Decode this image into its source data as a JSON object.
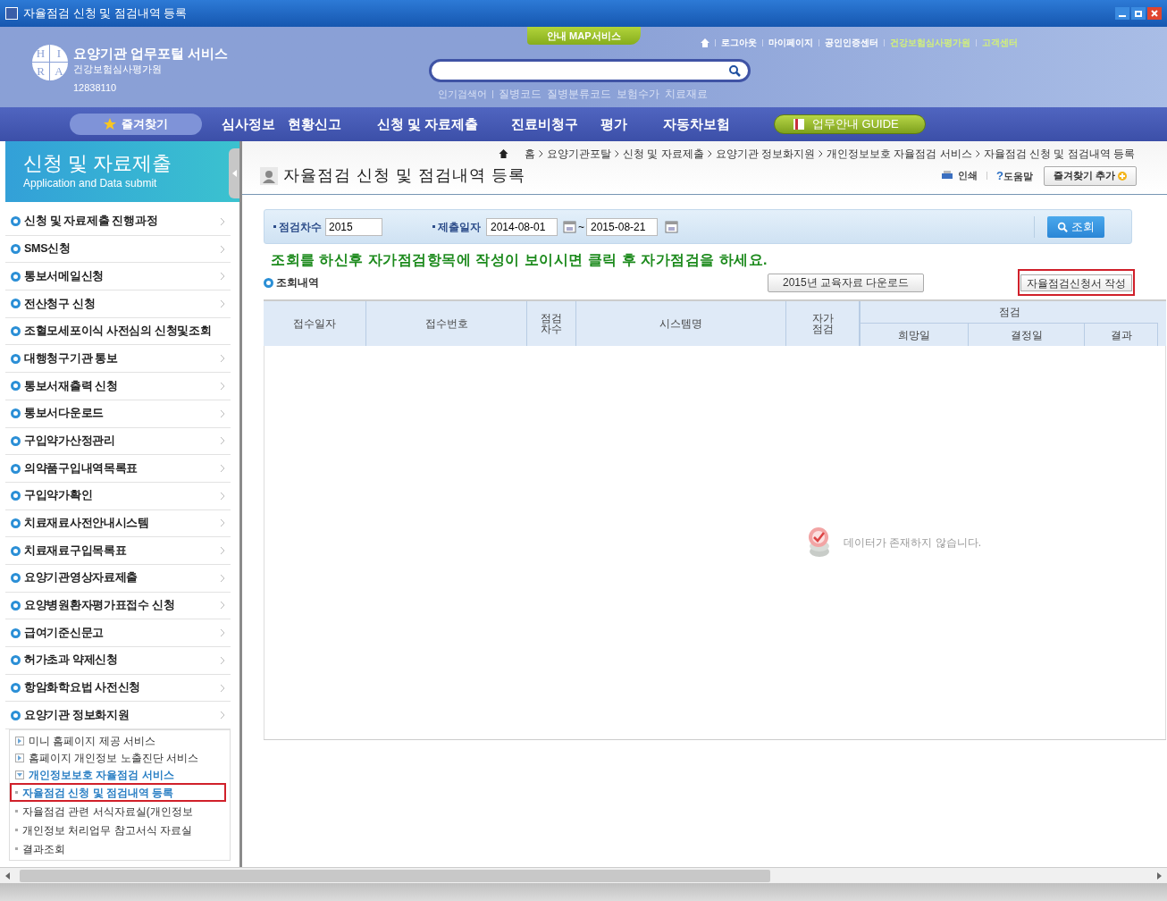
{
  "window": {
    "title": "자율점검 신청 및 점검내역 등록"
  },
  "header": {
    "logo_letters": [
      "H",
      "I",
      "R",
      "A"
    ],
    "org_name": "요양기관 업무포털 서비스",
    "org_subtitle": "건강보험심사평가원",
    "user_id": "12838110",
    "map_tab": "안내 MAP서비스",
    "top_links": [
      {
        "label": "로그아웃",
        "highlight": false
      },
      {
        "label": "마이페이지",
        "highlight": false
      },
      {
        "label": "공인인증센터",
        "highlight": false
      },
      {
        "label": "건강보험심사평가원",
        "highlight": true
      },
      {
        "label": "고객센터",
        "highlight": true
      }
    ],
    "quick_label": "인기검색어",
    "quick_links": [
      "질병코드",
      "질병분류코드",
      "보험수가",
      "치료재료"
    ]
  },
  "nav": {
    "favorites": "즐겨찾기",
    "items": [
      "심사정보",
      "현황신고",
      "신청 및 자료제출",
      "진료비청구",
      "평가",
      "자동차보험"
    ],
    "guide": "업무안내 GUIDE"
  },
  "sidebar": {
    "title": "신청 및 자료제출",
    "subtitle": "Application and Data submit",
    "items": [
      {
        "label": "신청 및 자료제출 진행과정",
        "arrow": true
      },
      {
        "label": "SMS신청",
        "arrow": true
      },
      {
        "label": "통보서메일신청",
        "arrow": true
      },
      {
        "label": "전산청구 신청",
        "arrow": true
      },
      {
        "label": "조혈모세포이식 사전심의 신청및조회",
        "arrow": false
      },
      {
        "label": "대행청구기관 통보",
        "arrow": true
      },
      {
        "label": "통보서재출력 신청",
        "arrow": true
      },
      {
        "label": "통보서다운로드",
        "arrow": true
      },
      {
        "label": "구입약가산정관리",
        "arrow": true
      },
      {
        "label": "의약품구입내역목록표",
        "arrow": true
      },
      {
        "label": "구입약가확인",
        "arrow": true
      },
      {
        "label": "치료재료사전안내시스템",
        "arrow": true
      },
      {
        "label": "치료재료구입목록표",
        "arrow": true
      },
      {
        "label": "요양기관영상자료제출",
        "arrow": true
      },
      {
        "label": "요양병원환자평가표접수 신청",
        "arrow": true
      },
      {
        "label": "급여기준신문고",
        "arrow": true
      },
      {
        "label": "허가초과 약제신청",
        "arrow": true
      },
      {
        "label": "항암화학요법 사전신청",
        "arrow": true
      },
      {
        "label": "요양기관 정보화지원",
        "arrow": true,
        "children": [
          {
            "label": "미니 홈페이지 제공 서비스",
            "expanded": false
          },
          {
            "label": "홈페이지 개인정보 노출진단 서비스",
            "expanded": false
          },
          {
            "label": "개인정보보호 자율점검 서비스",
            "expanded": true,
            "children": [
              {
                "label": "자율점검 신청 및 점검내역 등록",
                "selected": true
              },
              {
                "label": "자율점검 관련 서식자료실(개인정보",
                "selected": false
              },
              {
                "label": "개인정보 처리업무 참고서식 자료실",
                "selected": false
              },
              {
                "label": "결과조회",
                "selected": false
              }
            ]
          }
        ]
      }
    ]
  },
  "main": {
    "breadcrumb": [
      "홈",
      "요양기관포탈",
      "신청 및 자료제출",
      "요양기관 정보화지원",
      "개인정보보호 자율점검 서비스",
      "자율점검 신청 및 점검내역 등록"
    ],
    "page_title": "자율점검 신청 및 점검내역 등록",
    "tools": {
      "print": "인쇄",
      "help_mark": "?",
      "help": "도움말",
      "add_favorite": "즐겨찾기 추가"
    },
    "search": {
      "round_label": "점검차수",
      "round_value": "2015",
      "date_label": "제출일자",
      "date_from": "2014-08-01",
      "date_sep": "~",
      "date_to": "2015-08-21",
      "button": "조회"
    },
    "notice": "조회를 하신후 자가점검항목에 작성이 보이시면 클릭 후 자가점검을 하세요.",
    "section_title": "조회내역",
    "download_button": "2015년 교육자료 다운로드",
    "apply_button": "자율점검신청서 작성",
    "table": {
      "columns": [
        {
          "label": "접수일자"
        },
        {
          "label": "접수번호"
        },
        {
          "label": "점검차수",
          "narrow": true
        },
        {
          "label": "시스템명"
        },
        {
          "label": "자가점검",
          "narrow": true
        },
        {
          "label": "점검",
          "children": [
            "희망일",
            "결정일",
            "결과"
          ]
        }
      ]
    },
    "empty_message": "데이터가 존재하지 않습니다."
  }
}
